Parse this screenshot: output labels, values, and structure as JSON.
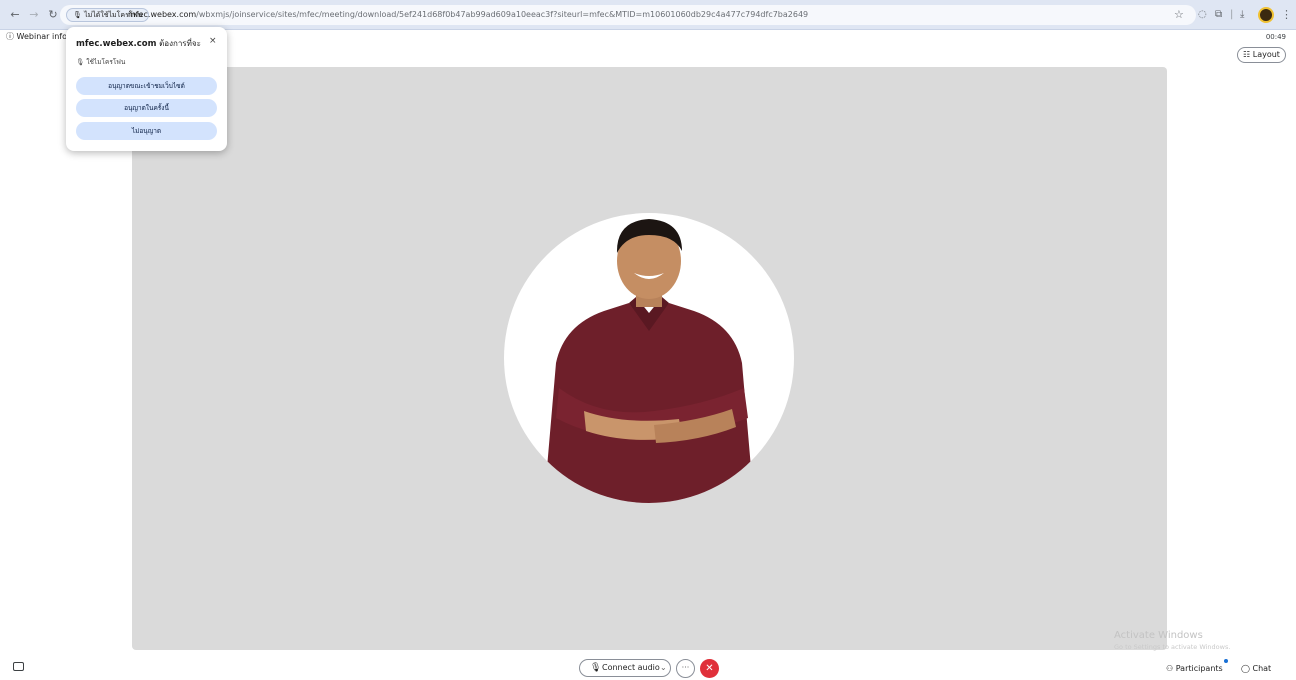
{
  "browser": {
    "site_chip_label": "ไม่ได้ใช้ไมโครโฟน",
    "url_host": "mfec.webex.com",
    "url_path": "/wbxmjs/joinservice/sites/mfec/meeting/download/5ef241d68f0b47ab99ad609a10eeac3f?siteurl=mfec&MTID=m10601060db29c4a477c794dfc7ba2649",
    "star": "☆",
    "ext_icon": "◌",
    "sidepanel_icon": "⧉",
    "download_icon": "⤓",
    "menu_dots": "⋮"
  },
  "meeting": {
    "webinar_info": "ⓘ Webinar info",
    "timer": "00:49",
    "layout_label": "Layout",
    "layout_icon": "☷"
  },
  "permission_popup": {
    "host": "mfec.webex.com",
    "request_suffix": "ต้องการที่จะ",
    "request_item": "ใช้ไมโครโฟน",
    "close": "×",
    "buttons": [
      "อนุญาตขณะเข้าชมเว็บไซต์",
      "อนุญาตในครั้งนี้",
      "ไม่อนุญาต"
    ]
  },
  "watermark": {
    "line1": "Activate Windows",
    "line2": "Go to Settings to activate Windows."
  },
  "bottom_bar": {
    "connect_audio_label": "Connect audio",
    "more_label": "···",
    "end_label": "✕",
    "participants_label": "Participants",
    "chat_label": "Chat"
  },
  "colors": {
    "stage_bg": "#dadada",
    "end_call": "#e0303a",
    "permission_button": "#d3e3fd",
    "participant_badge": "#1870d5"
  }
}
